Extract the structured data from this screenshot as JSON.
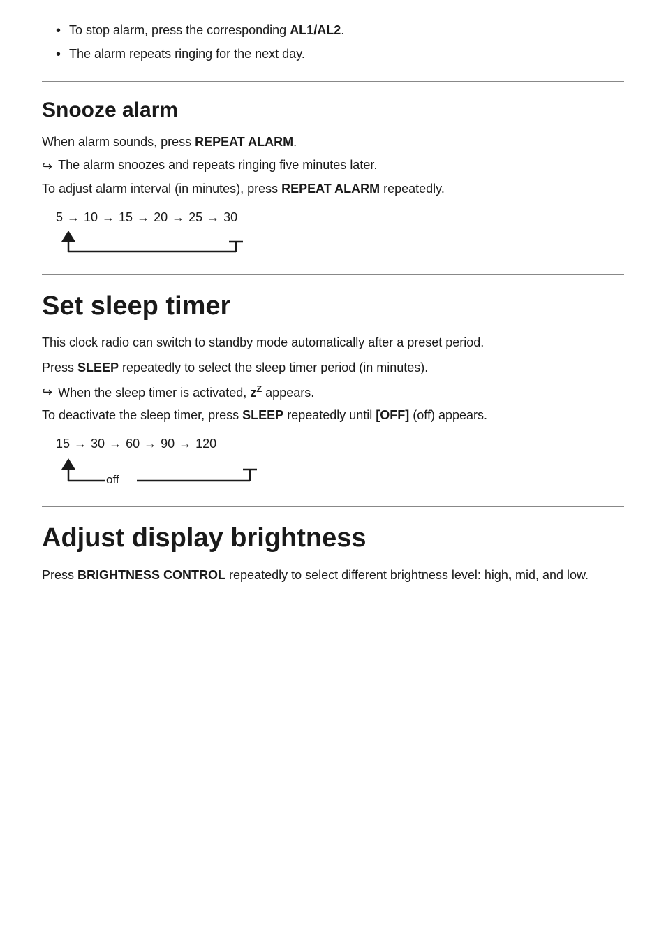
{
  "top": {
    "bullet1": "To stop alarm, press the corresponding ",
    "bullet1_bold": "AL1/AL2",
    "bullet1_end": ".",
    "bullet2": "The alarm repeats ringing for the next day."
  },
  "snooze": {
    "title": "Snooze alarm",
    "para1_start": "When alarm sounds, press ",
    "para1_bold": "REPEAT ALARM",
    "para1_end": ".",
    "result1": "The alarm snoozes and repeats ringing five minutes later.",
    "para2_start": "To adjust alarm interval (in minutes), press ",
    "para2_bold": "REPEAT ALARM",
    "para2_end": " repeatedly.",
    "flow": [
      "5",
      "10",
      "15",
      "20",
      "25",
      "30"
    ],
    "flow_arrow": "→"
  },
  "sleep": {
    "title": "Set sleep timer",
    "para1": "This clock radio can switch to standby mode automatically after a preset period.",
    "para2_start": "Press ",
    "para2_bold": "SLEEP",
    "para2_end": " repeatedly to select the sleep timer period (in minutes).",
    "result1_start": "When the sleep timer is activated, ",
    "result1_zz": "z",
    "result1_ZZ": "Z",
    "result1_end": " appears.",
    "para3_start": "To deactivate the sleep timer, press ",
    "para3_bold": "SLEEP",
    "para3_mid": " repeatedly until ",
    "para3_bracket": "[OFF]",
    "para3_off": " (off)",
    "para3_end": " appears.",
    "flow": [
      "15",
      "30",
      "60",
      "90",
      "120"
    ],
    "flow_arrow": "→",
    "off_label": "off"
  },
  "brightness": {
    "title": "Adjust display brightness",
    "para1_start": "Press ",
    "para1_bold": "BRIGHTNESS CONTROL",
    "para1_mid": " repeatedly to select different brightness level: high",
    "para1_comma": ",",
    "para1_end": " mid, and low."
  }
}
